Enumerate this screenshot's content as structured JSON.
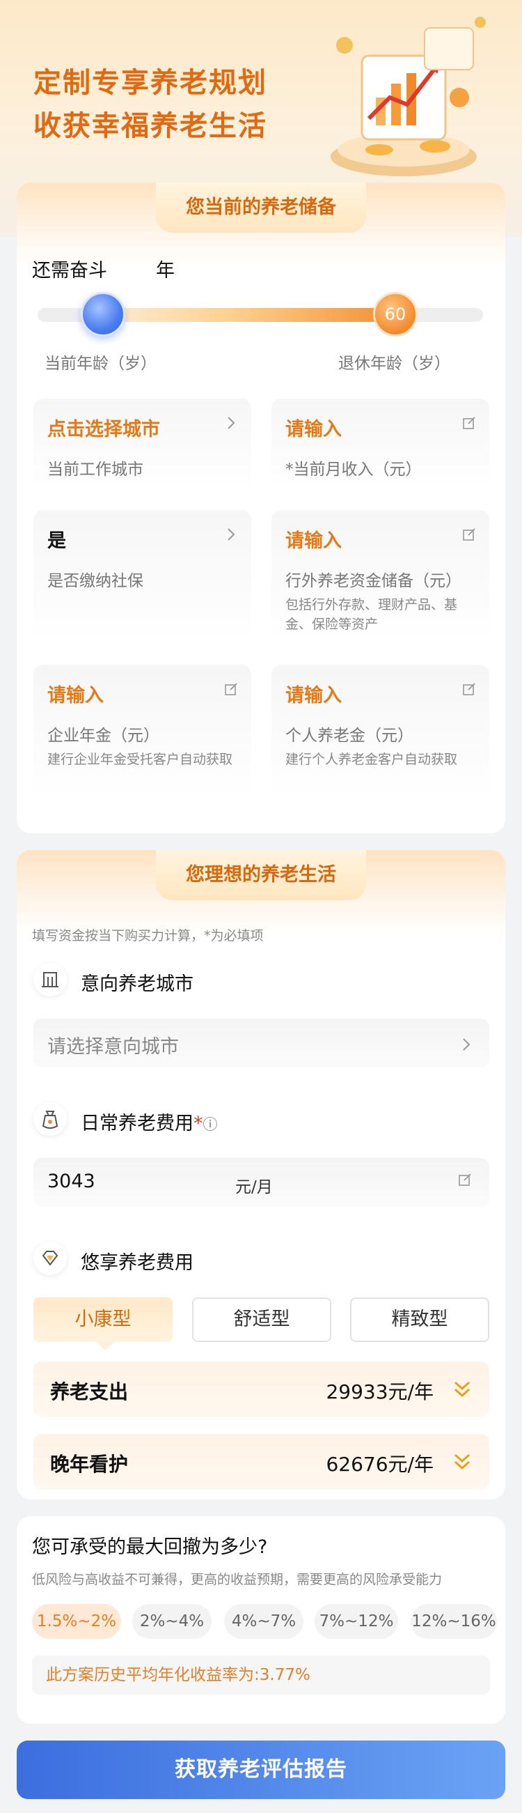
{
  "hero": {
    "line1": "定制专享养老规划",
    "line2": "收获幸福养老生活"
  },
  "current": {
    "section_title": "您当前的养老储备",
    "years_prefix": "还需奋斗",
    "years_suffix": "年",
    "retire_age": "60",
    "current_age_label": "当前年龄（岁）",
    "retire_age_label": "退休年龄（岁）",
    "tiles": [
      {
        "value": "点击选择城市",
        "label": "当前工作城市",
        "hint": ""
      },
      {
        "value": "请输入",
        "label": "*当前月收入（元）",
        "hint": ""
      },
      {
        "value": "是",
        "label": "是否缴纳社保",
        "hint": ""
      },
      {
        "value": "请输入",
        "label": "行外养老资金储备（元）",
        "hint": "包括行外存款、理财产品、基金、保险等资产"
      },
      {
        "value": "请输入",
        "label": "企业年金（元）",
        "hint": "建行企业年金受托客户自动获取"
      },
      {
        "value": "请输入",
        "label": "个人养老金（元）",
        "hint": "建行个人养老金客户自动获取"
      }
    ]
  },
  "ideal": {
    "section_title": "您理想的养老生活",
    "note": "填写资金按当下购买力计算，*为必填项",
    "city_title": "意向养老城市",
    "city_placeholder": "请选择意向城市",
    "daily_title": "日常养老费用",
    "required_mark": "*",
    "info_icon": "ⓘ",
    "daily_value": "3043",
    "daily_unit": "元/月",
    "enjoy_title": "悠享养老费用",
    "levels": [
      "小康型",
      "舒适型",
      "精致型"
    ],
    "selected_level": "小康型",
    "costs": [
      {
        "label": "养老支出",
        "value": "29933元/年"
      },
      {
        "label": "晚年看护",
        "value": "62676元/年"
      }
    ]
  },
  "risk": {
    "title": "您可承受的最大回撤为多少?",
    "subtitle": "低风险与高收益不可兼得，更高的收益预期，需要更高的风险承受能力",
    "options": [
      "1.5%~2%",
      "2%~4%",
      "4%~7%",
      "7%~12%",
      "12%~16%"
    ],
    "selected": "1.5%~2%",
    "rate_text": "此方案历史平均年化收益率为:3.77%"
  },
  "cta": {
    "label": "获取养老评估报告"
  },
  "colors": {
    "accent_orange": "#e37a17",
    "cta_blue": "#3c6ede"
  }
}
